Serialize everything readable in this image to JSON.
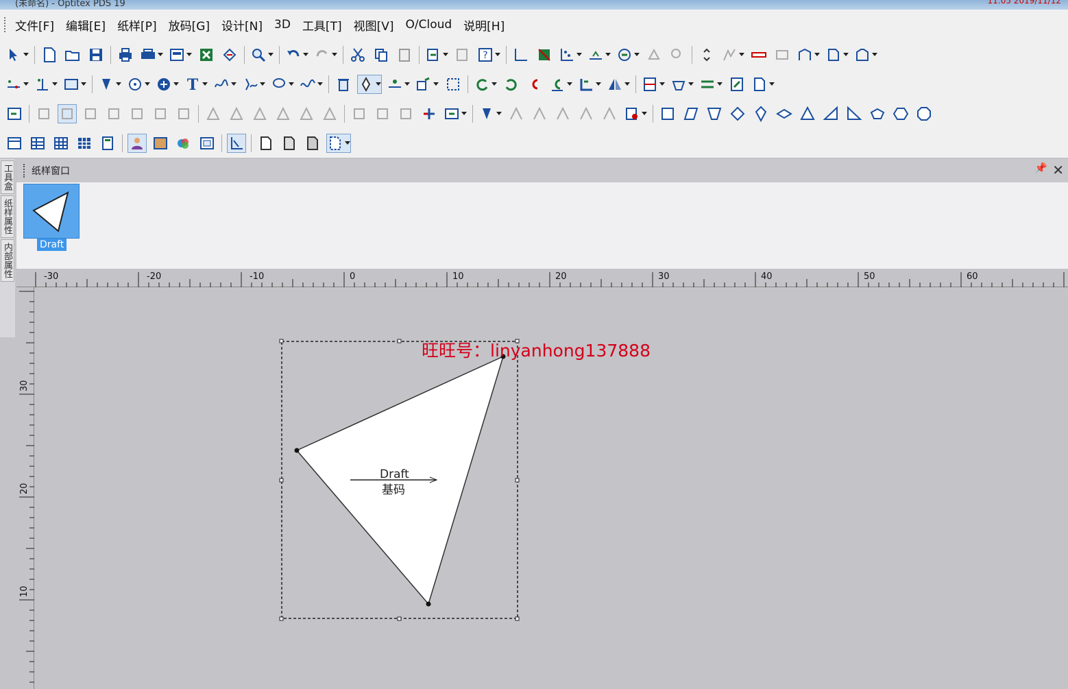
{
  "app": {
    "title": "(未命名) - Optitex PDS 19",
    "clock": "11:05 2019/11/12"
  },
  "menu": [
    "文件[F]",
    "编辑[E]",
    "纸样[P]",
    "放码[G]",
    "设计[N]",
    "3D",
    "工具[T]",
    "视图[V]",
    "O/Cloud",
    "说明[H]"
  ],
  "left_tabs": [
    "工具盒",
    "纸样属性",
    "内部属性"
  ],
  "panel": {
    "title": "纸样窗口",
    "pin": "📌",
    "close": "✕"
  },
  "pieces": [
    {
      "name": "Draft",
      "selected": true
    }
  ],
  "ruler": {
    "h_labels": [
      "-30",
      "-20",
      "-10",
      "0",
      "10",
      "20",
      "30",
      "40",
      "50",
      "60"
    ],
    "v_labels": [
      "30",
      "20",
      "10"
    ]
  },
  "piece": {
    "name": "Draft",
    "size": "基码",
    "fill": "#ffffff",
    "outline": "#333333"
  },
  "watermark": "旺旺号：linyanhong137888",
  "colors": {
    "workspace": "#c4c3c7",
    "selected_thumb": "#5aa6ec",
    "watermark": "#d4001a"
  }
}
